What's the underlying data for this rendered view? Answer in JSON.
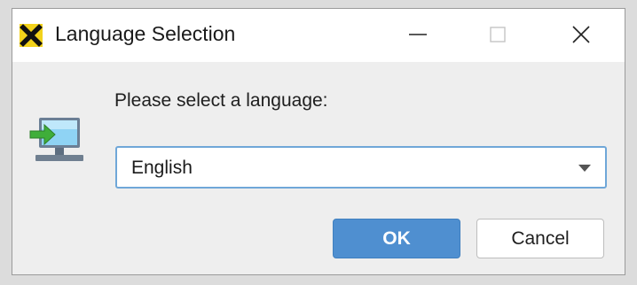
{
  "window": {
    "title": "Language Selection",
    "app_icon": "x-logo-icon",
    "controls": {
      "minimize": "minimize-icon",
      "maximize": "maximize-icon",
      "close": "close-icon"
    }
  },
  "dialog": {
    "icon": "monitor-import-icon",
    "prompt": "Please select a language:",
    "language_select": {
      "selected": "English"
    },
    "buttons": {
      "ok_label": "OK",
      "cancel_label": "Cancel"
    }
  },
  "colors": {
    "accent": "#4f8fd0",
    "focus_border": "#6fa7d8",
    "logo_bg": "#f2d21b"
  }
}
